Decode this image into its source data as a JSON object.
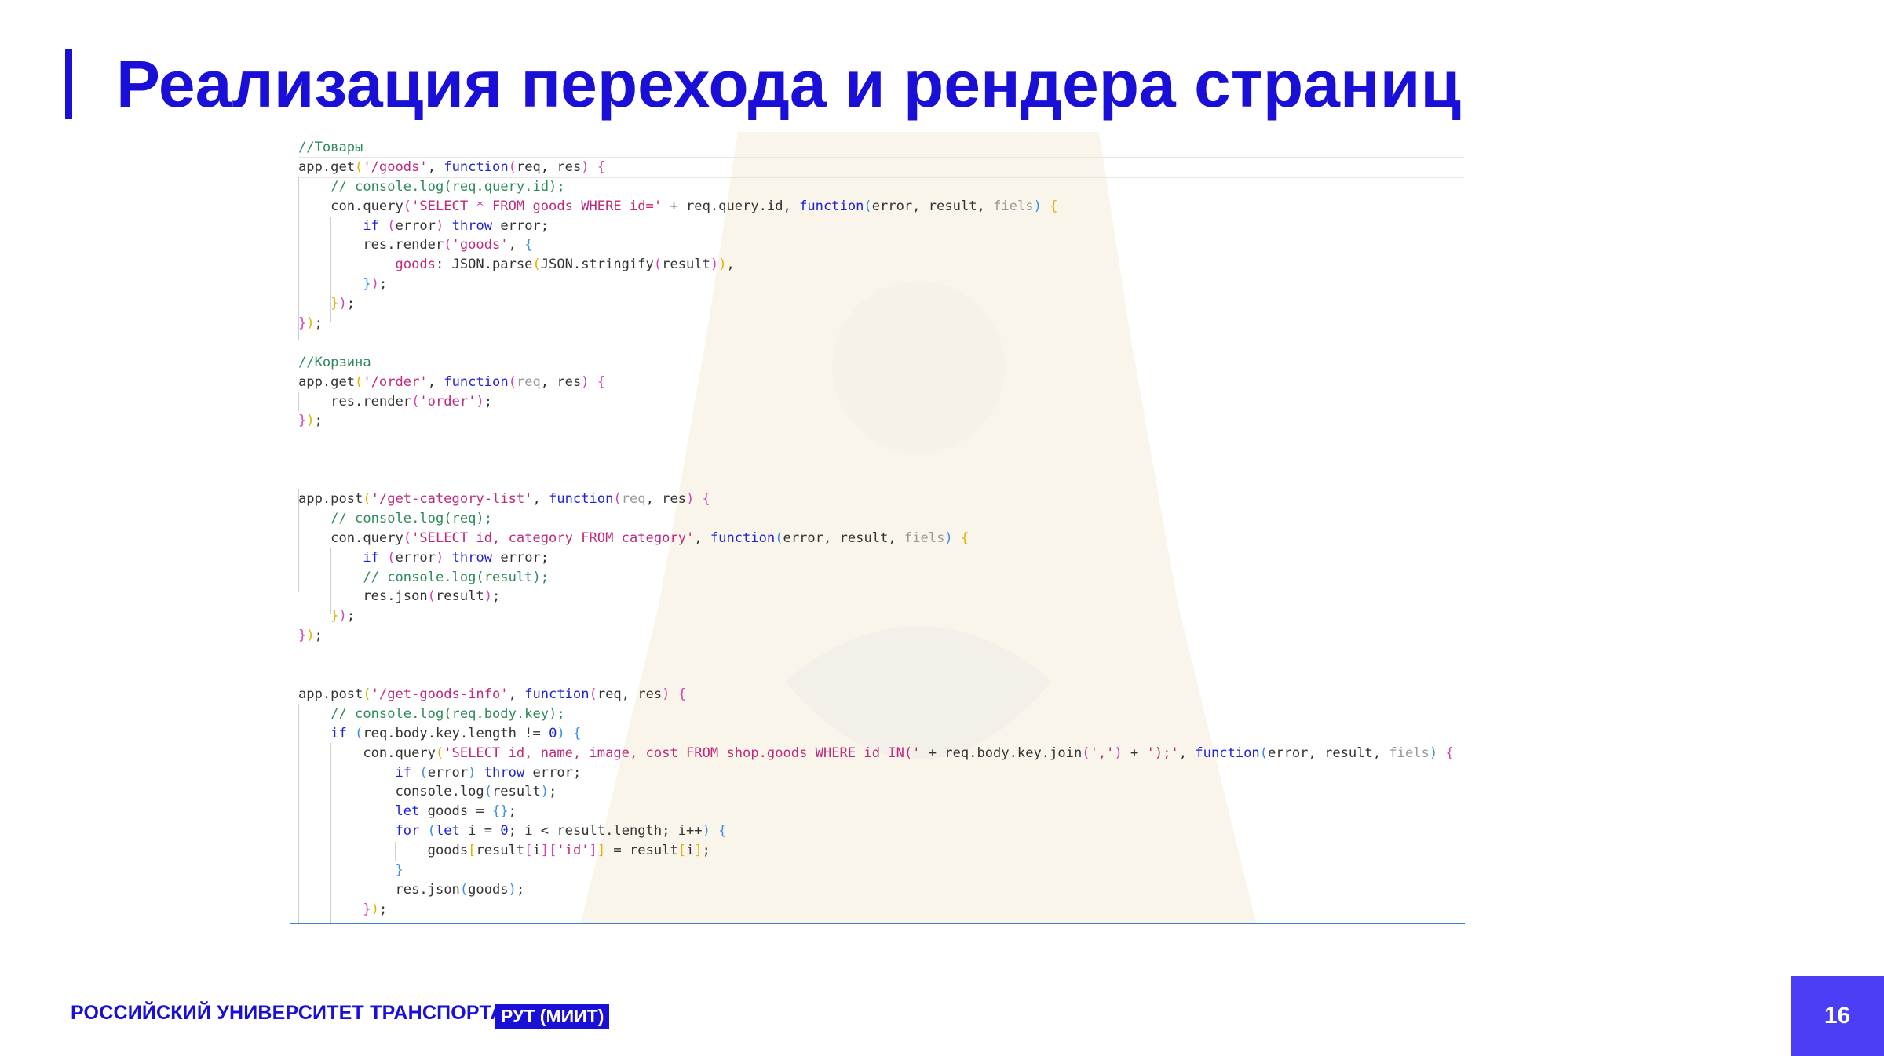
{
  "slide": {
    "title": "Реализация перехода и рендера страниц",
    "page_number": "16"
  },
  "footer": {
    "organization": "РОССИЙСКИЙ УНИВЕРСИТЕТ ТРАНСПОРТА",
    "badge": "РУТ (МИИТ)"
  },
  "colors": {
    "brand": "#1a0fd6",
    "page_box": "#4b3ef5",
    "code_comment": "#2e8b57",
    "code_keyword": "#1f23d6",
    "code_string": "#c02a7a",
    "code_param_faded": "#9a9a9a",
    "code_bracket_yellow": "#e0b300",
    "code_bracket_pink": "#d043b4",
    "code_bracket_blue": "#3a8ee6"
  },
  "code": {
    "lines": [
      [
        {
          "t": "//Товары",
          "c": "cm"
        }
      ],
      [
        {
          "t": "app.get"
        },
        {
          "t": "(",
          "c": "by"
        },
        {
          "t": "'/goods'",
          "c": "st"
        },
        {
          "t": ", "
        },
        {
          "t": "function",
          "c": "kw"
        },
        {
          "t": "(",
          "c": "bp"
        },
        {
          "t": "req, res"
        },
        {
          "t": ")",
          "c": "bp"
        },
        {
          "t": " "
        },
        {
          "t": "{",
          "c": "bp"
        }
      ],
      [
        {
          "t": "    "
        },
        {
          "t": "// console.log(req.query.id);",
          "c": "cm"
        }
      ],
      [
        {
          "t": "    con.query"
        },
        {
          "t": "(",
          "c": "bp"
        },
        {
          "t": "'SELECT * FROM goods WHERE id='",
          "c": "st"
        },
        {
          "t": " + req.query.id, "
        },
        {
          "t": "function",
          "c": "kw"
        },
        {
          "t": "(",
          "c": "bb"
        },
        {
          "t": "error, result, "
        },
        {
          "t": "fiels",
          "c": "fd"
        },
        {
          "t": ")",
          "c": "bb"
        },
        {
          "t": " "
        },
        {
          "t": "{",
          "c": "by"
        }
      ],
      [
        {
          "t": "        "
        },
        {
          "t": "if",
          "c": "kw"
        },
        {
          "t": " "
        },
        {
          "t": "(",
          "c": "bp"
        },
        {
          "t": "error"
        },
        {
          "t": ")",
          "c": "bp"
        },
        {
          "t": " "
        },
        {
          "t": "throw",
          "c": "kw"
        },
        {
          "t": " error;"
        }
      ],
      [
        {
          "t": "        res.render"
        },
        {
          "t": "(",
          "c": "bp"
        },
        {
          "t": "'goods'",
          "c": "st"
        },
        {
          "t": ", "
        },
        {
          "t": "{",
          "c": "bb"
        }
      ],
      [
        {
          "t": "            "
        },
        {
          "t": "goods",
          "c": "st"
        },
        {
          "t": ": JSON.parse"
        },
        {
          "t": "(",
          "c": "by"
        },
        {
          "t": "JSON.stringify"
        },
        {
          "t": "(",
          "c": "bp"
        },
        {
          "t": "result"
        },
        {
          "t": ")",
          "c": "bp"
        },
        {
          "t": ")",
          "c": "by"
        },
        {
          "t": ","
        }
      ],
      [
        {
          "t": "        "
        },
        {
          "t": "}",
          "c": "bb"
        },
        {
          "t": ")",
          "c": "bp"
        },
        {
          "t": ";"
        }
      ],
      [
        {
          "t": "    "
        },
        {
          "t": "}",
          "c": "by"
        },
        {
          "t": ")",
          "c": "bp"
        },
        {
          "t": ";"
        }
      ],
      [
        {
          "t": "}",
          "c": "bp"
        },
        {
          "t": ")",
          "c": "by"
        },
        {
          "t": ";"
        }
      ],
      [],
      [
        {
          "t": "//Корзина",
          "c": "cm"
        }
      ],
      [
        {
          "t": "app.get"
        },
        {
          "t": "(",
          "c": "by"
        },
        {
          "t": "'/order'",
          "c": "st"
        },
        {
          "t": ", "
        },
        {
          "t": "function",
          "c": "kw"
        },
        {
          "t": "(",
          "c": "bp"
        },
        {
          "t": "req",
          "c": "fd"
        },
        {
          "t": ", res"
        },
        {
          "t": ")",
          "c": "bp"
        },
        {
          "t": " "
        },
        {
          "t": "{",
          "c": "bp"
        }
      ],
      [
        {
          "t": "    res.render"
        },
        {
          "t": "(",
          "c": "bp"
        },
        {
          "t": "'order'",
          "c": "st"
        },
        {
          "t": ")",
          "c": "bp"
        },
        {
          "t": ";"
        }
      ],
      [
        {
          "t": "}",
          "c": "bp"
        },
        {
          "t": ")",
          "c": "by"
        },
        {
          "t": ";"
        }
      ],
      [],
      [],
      [],
      [
        {
          "t": "app.post"
        },
        {
          "t": "(",
          "c": "by"
        },
        {
          "t": "'/get-category-list'",
          "c": "st"
        },
        {
          "t": ", "
        },
        {
          "t": "function",
          "c": "kw"
        },
        {
          "t": "(",
          "c": "bp"
        },
        {
          "t": "req",
          "c": "fd"
        },
        {
          "t": ", res"
        },
        {
          "t": ")",
          "c": "bp"
        },
        {
          "t": " "
        },
        {
          "t": "{",
          "c": "bp"
        }
      ],
      [
        {
          "t": "    "
        },
        {
          "t": "// console.log(req);",
          "c": "cm"
        }
      ],
      [
        {
          "t": "    con.query"
        },
        {
          "t": "(",
          "c": "bp"
        },
        {
          "t": "'SELECT id, category FROM category'",
          "c": "st"
        },
        {
          "t": ", "
        },
        {
          "t": "function",
          "c": "kw"
        },
        {
          "t": "(",
          "c": "bb"
        },
        {
          "t": "error, result, "
        },
        {
          "t": "fiels",
          "c": "fd"
        },
        {
          "t": ")",
          "c": "bb"
        },
        {
          "t": " "
        },
        {
          "t": "{",
          "c": "by"
        }
      ],
      [
        {
          "t": "        "
        },
        {
          "t": "if",
          "c": "kw"
        },
        {
          "t": " "
        },
        {
          "t": "(",
          "c": "bp"
        },
        {
          "t": "error"
        },
        {
          "t": ")",
          "c": "bp"
        },
        {
          "t": " "
        },
        {
          "t": "throw",
          "c": "kw"
        },
        {
          "t": " error;"
        }
      ],
      [
        {
          "t": "        "
        },
        {
          "t": "// console.log(result);",
          "c": "cm"
        }
      ],
      [
        {
          "t": "        res.json"
        },
        {
          "t": "(",
          "c": "bp"
        },
        {
          "t": "result"
        },
        {
          "t": ")",
          "c": "bp"
        },
        {
          "t": ";"
        }
      ],
      [
        {
          "t": "    "
        },
        {
          "t": "}",
          "c": "by"
        },
        {
          "t": ")",
          "c": "bp"
        },
        {
          "t": ";"
        }
      ],
      [
        {
          "t": "}",
          "c": "bp"
        },
        {
          "t": ")",
          "c": "by"
        },
        {
          "t": ";"
        }
      ],
      [],
      [],
      [
        {
          "t": "app.post"
        },
        {
          "t": "(",
          "c": "by"
        },
        {
          "t": "'/get-goods-info'",
          "c": "st"
        },
        {
          "t": ", "
        },
        {
          "t": "function",
          "c": "kw"
        },
        {
          "t": "(",
          "c": "bp"
        },
        {
          "t": "req, res"
        },
        {
          "t": ")",
          "c": "bp"
        },
        {
          "t": " "
        },
        {
          "t": "{",
          "c": "bp"
        }
      ],
      [
        {
          "t": "    "
        },
        {
          "t": "// console.log(req.body.key);",
          "c": "cm"
        }
      ],
      [
        {
          "t": "    "
        },
        {
          "t": "if",
          "c": "kw"
        },
        {
          "t": " "
        },
        {
          "t": "(",
          "c": "bb"
        },
        {
          "t": "req.body.key.length != "
        },
        {
          "t": "0",
          "c": "kw"
        },
        {
          "t": ")",
          "c": "bb"
        },
        {
          "t": " "
        },
        {
          "t": "{",
          "c": "bb"
        }
      ],
      [
        {
          "t": "        con.query"
        },
        {
          "t": "(",
          "c": "by"
        },
        {
          "t": "'SELECT id, name, image, cost FROM shop.goods WHERE id IN('",
          "c": "st"
        },
        {
          "t": " + req.body.key.join"
        },
        {
          "t": "(",
          "c": "bp"
        },
        {
          "t": "','",
          "c": "st"
        },
        {
          "t": ")",
          "c": "bp"
        },
        {
          "t": " + "
        },
        {
          "t": "');'",
          "c": "st"
        },
        {
          "t": ", "
        },
        {
          "t": "function",
          "c": "kw"
        },
        {
          "t": "(",
          "c": "bb"
        },
        {
          "t": "error, result, "
        },
        {
          "t": "fiels",
          "c": "fd"
        },
        {
          "t": ")",
          "c": "bb"
        },
        {
          "t": " "
        },
        {
          "t": "{",
          "c": "bp"
        }
      ],
      [
        {
          "t": "            "
        },
        {
          "t": "if",
          "c": "kw"
        },
        {
          "t": " "
        },
        {
          "t": "(",
          "c": "bb"
        },
        {
          "t": "error"
        },
        {
          "t": ")",
          "c": "bb"
        },
        {
          "t": " "
        },
        {
          "t": "throw",
          "c": "kw"
        },
        {
          "t": " error;"
        }
      ],
      [
        {
          "t": "            console.log"
        },
        {
          "t": "(",
          "c": "bb"
        },
        {
          "t": "result"
        },
        {
          "t": ")",
          "c": "bb"
        },
        {
          "t": ";"
        }
      ],
      [
        {
          "t": "            "
        },
        {
          "t": "let",
          "c": "kw"
        },
        {
          "t": " goods = "
        },
        {
          "t": "{}",
          "c": "bb"
        },
        {
          "t": ";"
        }
      ],
      [
        {
          "t": "            "
        },
        {
          "t": "for",
          "c": "kw"
        },
        {
          "t": " "
        },
        {
          "t": "(",
          "c": "bb"
        },
        {
          "t": "let",
          "c": "kw"
        },
        {
          "t": " i = "
        },
        {
          "t": "0",
          "c": "kw"
        },
        {
          "t": "; i < result.length; i++"
        },
        {
          "t": ")",
          "c": "bb"
        },
        {
          "t": " "
        },
        {
          "t": "{",
          "c": "bb"
        }
      ],
      [
        {
          "t": "                goods"
        },
        {
          "t": "[",
          "c": "by"
        },
        {
          "t": "result"
        },
        {
          "t": "[",
          "c": "bp"
        },
        {
          "t": "i"
        },
        {
          "t": "]",
          "c": "bp"
        },
        {
          "t": "[",
          "c": "bp"
        },
        {
          "t": "'id'",
          "c": "st"
        },
        {
          "t": "]",
          "c": "bp"
        },
        {
          "t": "]",
          "c": "by"
        },
        {
          "t": " = result"
        },
        {
          "t": "[",
          "c": "by"
        },
        {
          "t": "i"
        },
        {
          "t": "]",
          "c": "by"
        },
        {
          "t": ";"
        }
      ],
      [
        {
          "t": "            "
        },
        {
          "t": "}",
          "c": "bb"
        }
      ],
      [
        {
          "t": "            res.json"
        },
        {
          "t": "(",
          "c": "bb"
        },
        {
          "t": "goods"
        },
        {
          "t": ")",
          "c": "bb"
        },
        {
          "t": ";"
        }
      ],
      [
        {
          "t": "        "
        },
        {
          "t": "}",
          "c": "bp"
        },
        {
          "t": ")",
          "c": "by"
        },
        {
          "t": ";"
        }
      ]
    ]
  }
}
